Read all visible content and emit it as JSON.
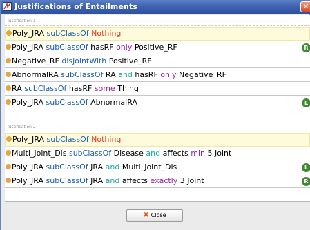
{
  "window": {
    "title": "Justifications of Entailments",
    "close_glyph": "✕"
  },
  "sections": [
    {
      "label": "Justification 1",
      "entailment": [
        "Poly_JRA ",
        "subClassOf",
        " ",
        "Nothing"
      ],
      "axioms": [
        {
          "parts": [
            "Poly_JRA ",
            "subClassOf",
            " hasRF ",
            "only",
            " Positive_RF"
          ],
          "badge": "R"
        },
        {
          "parts": [
            "Negative_RF ",
            "disjointWith",
            " Positive_RF"
          ],
          "badge": ""
        },
        {
          "parts": [
            "AbnormalRA ",
            "subClassOf",
            " RA ",
            "and",
            " hasRF ",
            "only",
            " Negative_RF"
          ],
          "badge": ""
        },
        {
          "parts": [
            "RA ",
            "subClassOf",
            " hasRF ",
            "some",
            " Thing"
          ],
          "badge": ""
        },
        {
          "parts": [
            "Poly_JRA ",
            "subClassOf",
            " AbnormalRA"
          ],
          "badge": "L"
        }
      ]
    },
    {
      "label": "Justification 2",
      "entailment": [
        "Poly_JRA ",
        "subClassOf",
        " ",
        "Nothing"
      ],
      "axioms": [
        {
          "parts": [
            "Multi_Joint_Dis ",
            "subClassOf",
            " Disease ",
            "and",
            " affects ",
            "min",
            " 5 Joint"
          ],
          "badge": ""
        },
        {
          "parts": [
            "Poly_JRA ",
            "subClassOf",
            " JRA ",
            "and",
            " Multi_Joint_Dis"
          ],
          "badge": "L"
        },
        {
          "parts": [
            "Poly_JRA ",
            "subClassOf",
            " JRA ",
            "and",
            " affects ",
            "exactly",
            " 3 Joint"
          ],
          "badge": "R"
        }
      ]
    }
  ],
  "footer": {
    "close_label": "Close",
    "close_icon": "✖"
  },
  "icons": {
    "window_icon": "app-window-icon",
    "bullet": "axiom-bullet-icon",
    "badge": "axiom-badge-icon"
  },
  "colors": {
    "keyword": "#1c5fa8",
    "nothing": "#e03a28",
    "operator": "#1aa2a0",
    "quantifier": "#9b1ea3",
    "bullet": "#e5a640",
    "badge": "#3f8a31",
    "highlight": "#fdfbdc"
  }
}
